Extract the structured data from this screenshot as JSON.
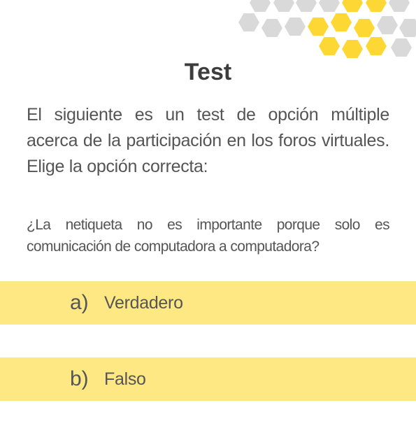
{
  "title": "Test",
  "intro": "El siguiente es un test de opción múltiple acerca de la participación en los foros virtuales. Elige la opción correcta:",
  "question": "¿La netiqueta no es importante porque solo es comunicación de computadora a computadora?",
  "options": [
    {
      "letter": "a)",
      "label": "Verdadero"
    },
    {
      "letter": "b)",
      "label": "Falso"
    }
  ],
  "colors": {
    "option_background": "#fde883",
    "hex_yellow": "#fdd835",
    "hex_gray": "#d9d9d9",
    "text": "#555555",
    "title": "#3d3d3d"
  },
  "icons": {
    "decoration": "honeycomb-pattern-icon"
  }
}
